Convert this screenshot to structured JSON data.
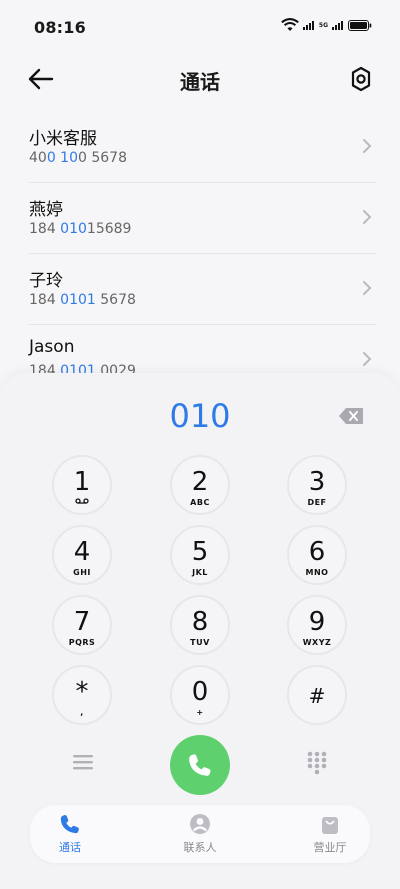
{
  "status_bar": {
    "time": "08:16",
    "network_label": "5G"
  },
  "header": {
    "title": "通话"
  },
  "contacts": [
    {
      "name": "小米客服",
      "number_parts": [
        {
          "t": "40",
          "hl": false
        },
        {
          "t": "0 10",
          "hl": true
        },
        {
          "t": "0 5678",
          "hl": false
        }
      ]
    },
    {
      "name": "燕婷",
      "number_parts": [
        {
          "t": "184 ",
          "hl": false
        },
        {
          "t": "010",
          "hl": true
        },
        {
          "t": "15689",
          "hl": false
        }
      ]
    },
    {
      "name": "子玲",
      "number_parts": [
        {
          "t": "184 ",
          "hl": false
        },
        {
          "t": "0101",
          "hl": true
        },
        {
          "t": " 5678",
          "hl": false
        }
      ]
    },
    {
      "name": "Jason",
      "number_parts": [
        {
          "t": "184 ",
          "hl": false
        },
        {
          "t": "0101",
          "hl": true
        },
        {
          "t": " 0029",
          "hl": false
        }
      ]
    }
  ],
  "dialer": {
    "entered_number": "010",
    "keys": [
      {
        "digit": "1",
        "letters": "",
        "voicemail": true
      },
      {
        "digit": "2",
        "letters": "ABC"
      },
      {
        "digit": "3",
        "letters": "DEF"
      },
      {
        "digit": "4",
        "letters": "GHI"
      },
      {
        "digit": "5",
        "letters": "JKL"
      },
      {
        "digit": "6",
        "letters": "MNO"
      },
      {
        "digit": "7",
        "letters": "PQRS"
      },
      {
        "digit": "8",
        "letters": "TUV"
      },
      {
        "digit": "9",
        "letters": "WXYZ"
      },
      {
        "digit": "*",
        "letters": ","
      },
      {
        "digit": "0",
        "letters": "+"
      },
      {
        "digit": "#",
        "letters": ""
      }
    ],
    "call_button_color": "#5ed16e"
  },
  "bottom_nav": [
    {
      "label": "通话",
      "icon": "phone-icon",
      "active": true
    },
    {
      "label": "联系人",
      "icon": "contacts-icon",
      "active": false
    },
    {
      "label": "营业厅",
      "icon": "shopping-bag-icon",
      "active": false
    }
  ],
  "colors": {
    "accent": "#2f7be6",
    "call": "#5ed16e"
  }
}
